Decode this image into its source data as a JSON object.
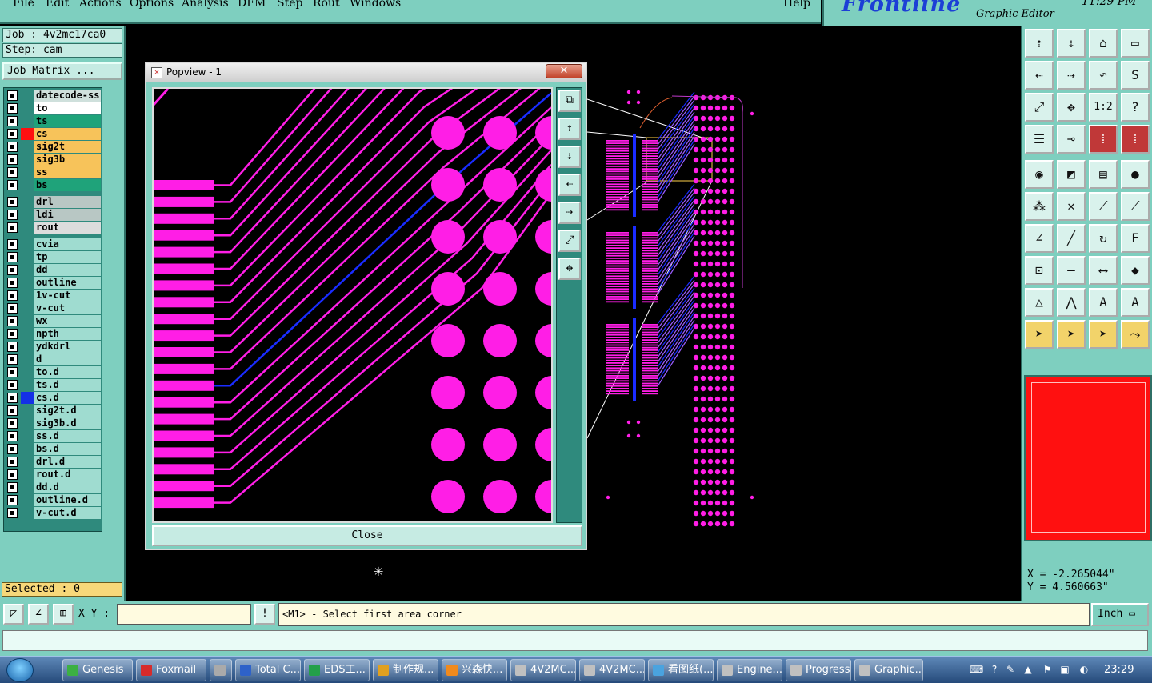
{
  "menu": [
    "File",
    "Edit",
    "Actions",
    "Options",
    "Analysis",
    "DFM",
    "Step",
    "Rout",
    "Windows"
  ],
  "help": "Help",
  "brand": {
    "logo": "Frontline",
    "subtitle": "Graphic Editor",
    "clock": "11:29 PM"
  },
  "job": {
    "job_line": "Job : 4v2mc17ca0",
    "step_line": "Step: cam",
    "matrix_label": "Job Matrix ..."
  },
  "layers": [
    {
      "name": "datecode-ss",
      "bg": "#cfe0dc",
      "sw": ""
    },
    {
      "name": "to",
      "bg": "#ffffff",
      "sw": ""
    },
    {
      "name": "ts",
      "bg": "#1fa37a",
      "sw": ""
    },
    {
      "name": "cs",
      "bg": "#f7c35a",
      "sw": "#ff1010"
    },
    {
      "name": "sig2t",
      "bg": "#f7c35a",
      "sw": ""
    },
    {
      "name": "sig3b",
      "bg": "#f7c35a",
      "sw": ""
    },
    {
      "name": "ss",
      "bg": "#f7c35a",
      "sw": ""
    },
    {
      "name": "bs",
      "bg": "#1fa37a",
      "sw": ""
    },
    {
      "name": "drl",
      "bg": "#b8c7c4",
      "sw": ""
    },
    {
      "name": "ldi",
      "bg": "#b8c7c4",
      "sw": ""
    },
    {
      "name": "rout",
      "bg": "#dcdcdc",
      "sw": ""
    },
    {
      "name": "cvia",
      "bg": "#9fdcd0",
      "sw": ""
    },
    {
      "name": "tp",
      "bg": "#9fdcd0",
      "sw": ""
    },
    {
      "name": "dd",
      "bg": "#9fdcd0",
      "sw": ""
    },
    {
      "name": "outline",
      "bg": "#9fdcd0",
      "sw": ""
    },
    {
      "name": "1v-cut",
      "bg": "#9fdcd0",
      "sw": ""
    },
    {
      "name": "v-cut",
      "bg": "#9fdcd0",
      "sw": ""
    },
    {
      "name": "wx",
      "bg": "#9fdcd0",
      "sw": ""
    },
    {
      "name": "npth",
      "bg": "#9fdcd0",
      "sw": ""
    },
    {
      "name": "ydkdrl",
      "bg": "#9fdcd0",
      "sw": ""
    },
    {
      "name": "d",
      "bg": "#9fdcd0",
      "sw": ""
    },
    {
      "name": "to.d",
      "bg": "#9fdcd0",
      "sw": ""
    },
    {
      "name": "ts.d",
      "bg": "#9fdcd0",
      "sw": ""
    },
    {
      "name": "cs.d",
      "bg": "#9fdcd0",
      "sw": "#1430e6"
    },
    {
      "name": "sig2t.d",
      "bg": "#9fdcd0",
      "sw": ""
    },
    {
      "name": "sig3b.d",
      "bg": "#9fdcd0",
      "sw": ""
    },
    {
      "name": "ss.d",
      "bg": "#9fdcd0",
      "sw": ""
    },
    {
      "name": "bs.d",
      "bg": "#9fdcd0",
      "sw": ""
    },
    {
      "name": "drl.d",
      "bg": "#9fdcd0",
      "sw": ""
    },
    {
      "name": "rout.d",
      "bg": "#9fdcd0",
      "sw": ""
    },
    {
      "name": "dd.d",
      "bg": "#9fdcd0",
      "sw": ""
    },
    {
      "name": "outline.d",
      "bg": "#9fdcd0",
      "sw": ""
    },
    {
      "name": "v-cut.d",
      "bg": "#9fdcd0",
      "sw": ""
    }
  ],
  "selected": "Selected : 0",
  "popview": {
    "title": "Popview - 1",
    "close_label": "Close",
    "close_x": "✕"
  },
  "coords": {
    "x": "X = -2.265044\"",
    "y": "Y = 4.560663\""
  },
  "cmd": {
    "xy_label": "X Y :",
    "xy_value": "",
    "prompt": "<M1> - Select first area corner",
    "units": "Inch"
  },
  "taskbar": {
    "items": [
      "Genesis",
      "Foxmail",
      "",
      "Total C...",
      "EDS工...",
      "制作规...",
      "兴森快...",
      "4V2MC...",
      "4V2MC...",
      "看图纸(...",
      "Engine...",
      "Progress",
      "Graphic..."
    ],
    "clock": "23:29"
  },
  "colors": {
    "copper": "#ff1ee6",
    "trace_blue": "#1a2cff",
    "panel": "#7ecfbf"
  }
}
